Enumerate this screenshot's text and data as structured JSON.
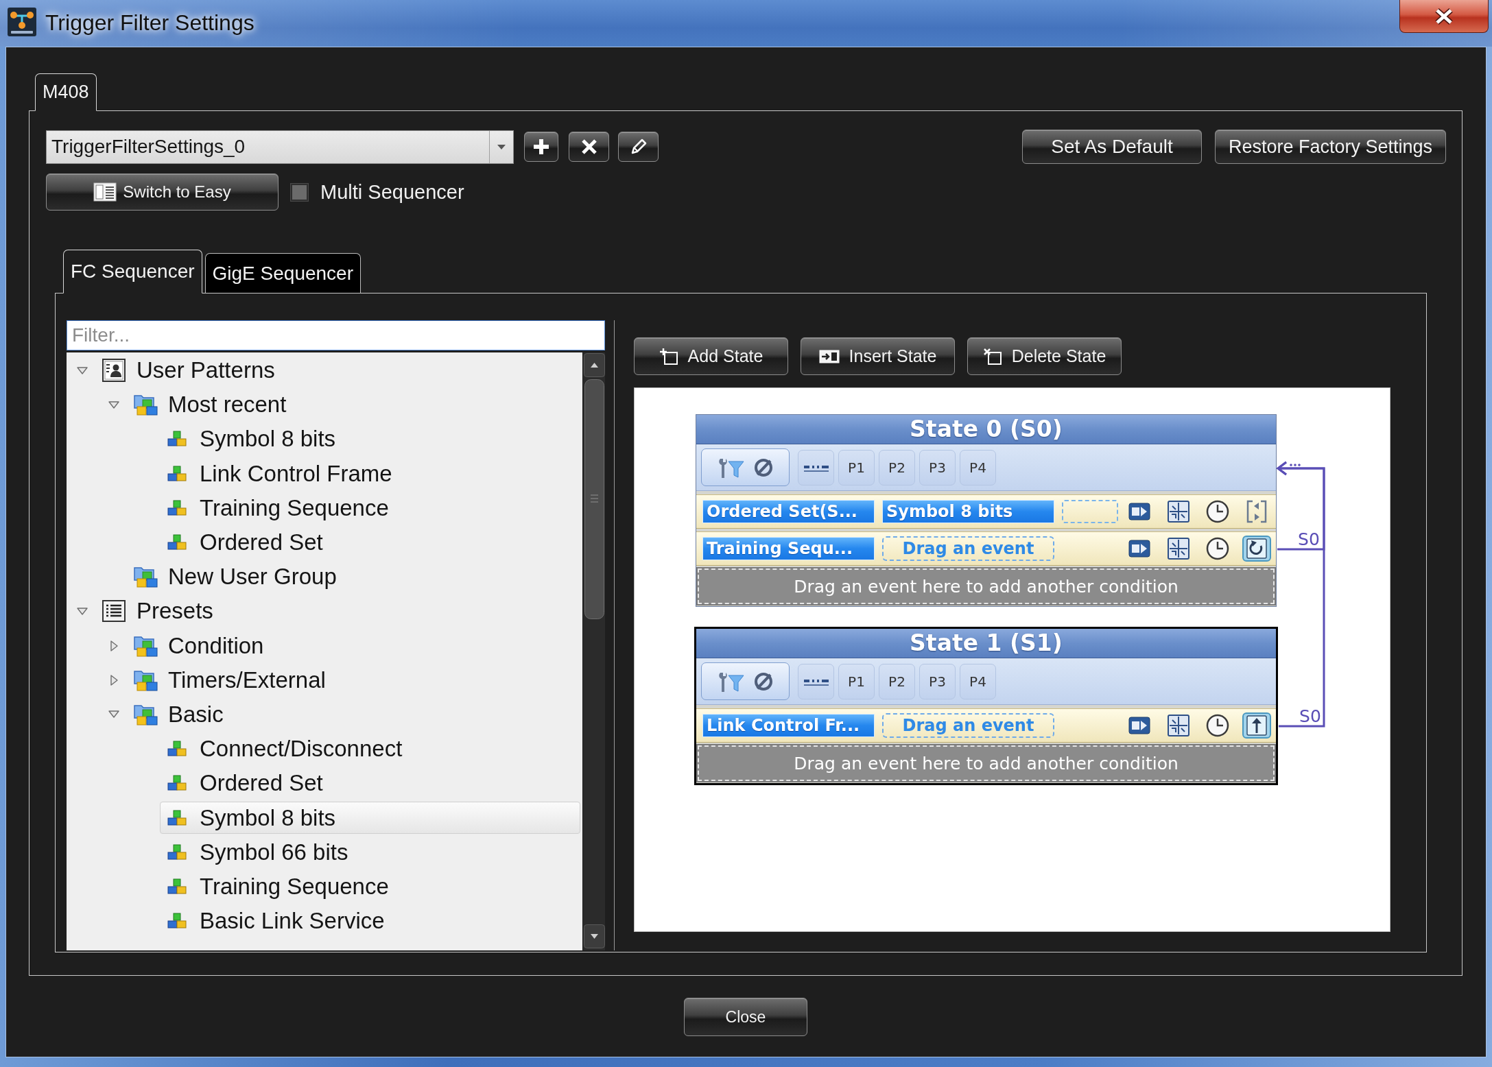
{
  "window": {
    "title": "Trigger Filter Settings"
  },
  "device_tabs": [
    {
      "label": "M408",
      "selected": true
    }
  ],
  "settings": {
    "profile": {
      "value": "TriggerFilterSettings_0"
    },
    "set_default": "Set As Default",
    "restore_defaults": "Restore Factory Settings",
    "switch_mode": "Switch to Easy",
    "multi_sequencer": {
      "label": "Multi Sequencer",
      "checked": false
    }
  },
  "sequencer_tabs": [
    {
      "label": "FC Sequencer",
      "selected": true
    },
    {
      "label": "GigE Sequencer",
      "selected": false
    }
  ],
  "patterns": {
    "filter": {
      "placeholder": "Filter..."
    },
    "tree": [
      {
        "label": "User Patterns",
        "kind": "contacts",
        "expanded": true,
        "selected": false,
        "children": [
          {
            "label": "Most recent",
            "kind": "group",
            "expanded": true,
            "selected": false,
            "children": [
              {
                "label": "Symbol 8 bits",
                "kind": "pattern",
                "selected": false
              },
              {
                "label": "Link Control Frame",
                "kind": "pattern",
                "selected": false
              },
              {
                "label": "Training Sequence",
                "kind": "pattern",
                "selected": false
              },
              {
                "label": "Ordered Set",
                "kind": "pattern",
                "selected": false
              }
            ]
          },
          {
            "label": "New User Group",
            "kind": "group",
            "selected": false
          }
        ]
      },
      {
        "label": "Presets",
        "kind": "list",
        "expanded": true,
        "selected": false,
        "children": [
          {
            "label": "Condition",
            "kind": "group",
            "expanded": false,
            "selected": false
          },
          {
            "label": "Timers/External",
            "kind": "group",
            "expanded": false,
            "selected": false
          },
          {
            "label": "Basic",
            "kind": "group",
            "expanded": true,
            "selected": false,
            "children": [
              {
                "label": "Connect/Disconnect",
                "kind": "pattern",
                "selected": false
              },
              {
                "label": "Ordered Set",
                "kind": "pattern",
                "selected": false
              },
              {
                "label": "Symbol 8 bits",
                "kind": "pattern",
                "selected": true
              },
              {
                "label": "Symbol 66 bits",
                "kind": "pattern",
                "selected": false
              },
              {
                "label": "Training Sequence",
                "kind": "pattern",
                "selected": false
              },
              {
                "label": "Basic Link Service",
                "kind": "pattern",
                "selected": false
              }
            ]
          }
        ]
      }
    ]
  },
  "state_toolbar": [
    {
      "kind": "add",
      "label": "Add State"
    },
    {
      "kind": "insert",
      "label": "Insert State"
    },
    {
      "kind": "delete",
      "label": "Delete State"
    }
  ],
  "states": [
    {
      "title": "State 0 (S0)",
      "selected": false,
      "pattern_buttons": [
        "P1",
        "P2",
        "P3",
        "P4"
      ],
      "conditions": [
        {
          "events": [
            {
              "kind": "event",
              "label": "Ordered Set(S..."
            },
            {
              "kind": "event",
              "label": "Symbol 8 bits"
            },
            {
              "kind": "slot"
            }
          ],
          "transition": {
            "kind": "goto"
          }
        },
        {
          "events": [
            {
              "kind": "event",
              "label": "Training Sequ..."
            },
            {
              "kind": "prompt",
              "label": "Drag an event"
            }
          ],
          "transition": {
            "kind": "loop",
            "label": "S0"
          }
        }
      ],
      "drop_hint": "Drag an event here to add another condition"
    },
    {
      "title": "State 1 (S1)",
      "selected": true,
      "pattern_buttons": [
        "P1",
        "P2",
        "P3",
        "P4"
      ],
      "conditions": [
        {
          "events": [
            {
              "kind": "event",
              "label": "Link Control Fr..."
            },
            {
              "kind": "prompt",
              "label": "Drag an event"
            }
          ],
          "transition": {
            "kind": "jump",
            "label": "S0"
          }
        }
      ],
      "drop_hint": "Drag an event here to add another condition"
    }
  ],
  "footer": {
    "close": "Close"
  }
}
